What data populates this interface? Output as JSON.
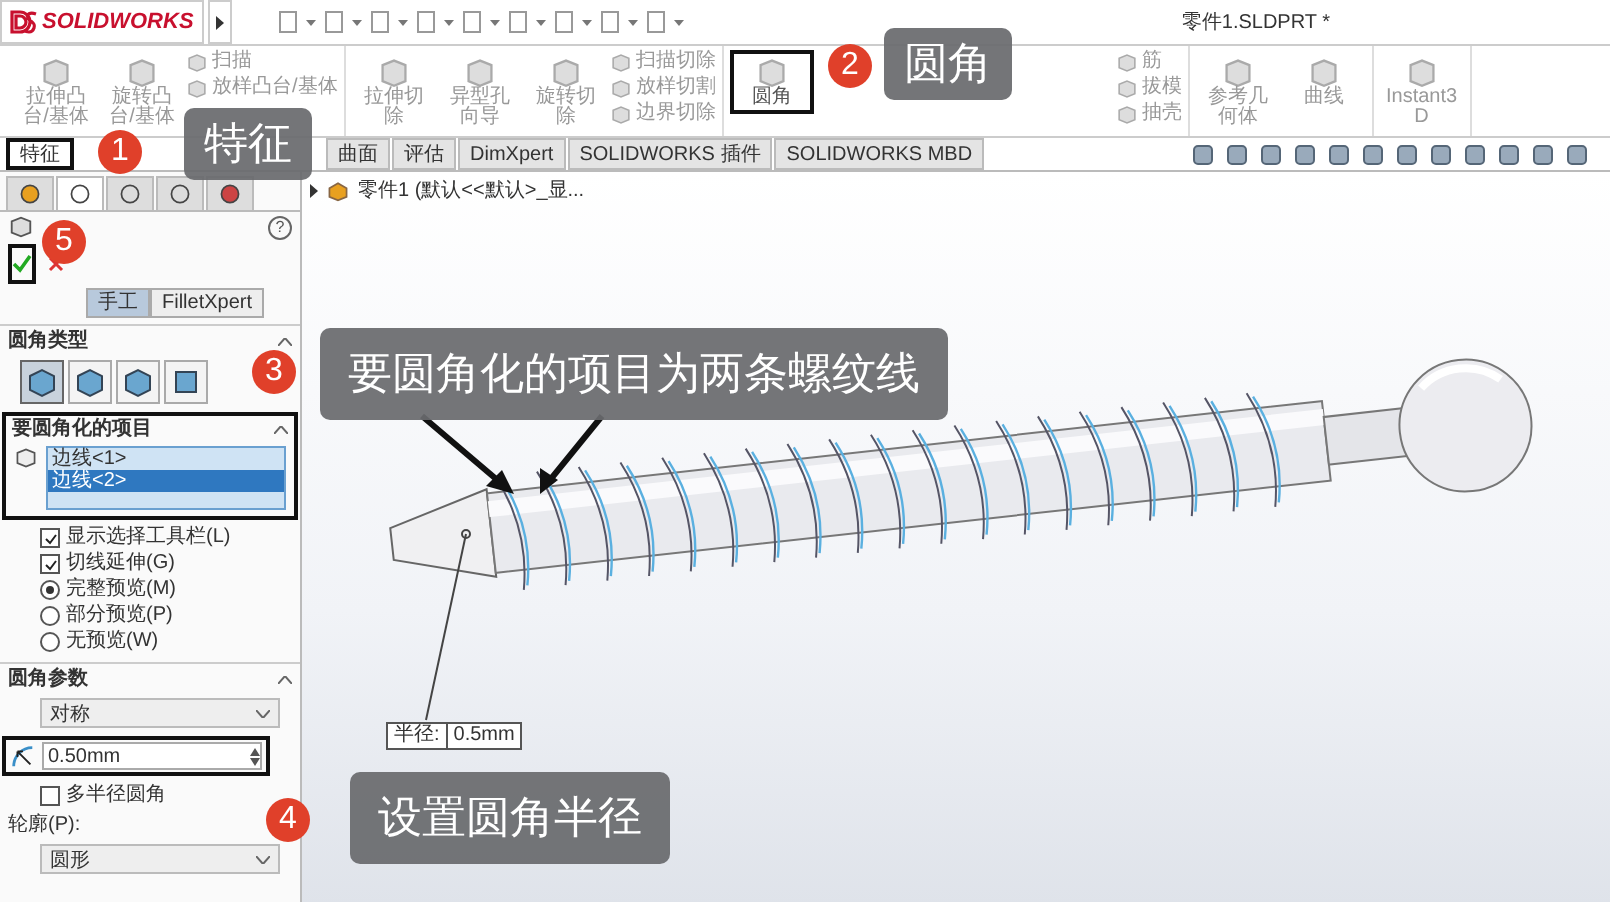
{
  "app": {
    "logo": "SOLIDWORKS",
    "title": "零件1.SLDPRT *"
  },
  "ribbon": {
    "groups": [
      {
        "items": [
          {
            "kind": "big",
            "label": "拉伸凸台/基体",
            "highlighted": false
          },
          {
            "kind": "big",
            "label": "旋转凸台/基体",
            "highlighted": false
          },
          {
            "kind": "small",
            "labels": [
              "扫描",
              "放样凸台/基体"
            ]
          }
        ]
      },
      {
        "items": [
          {
            "kind": "big",
            "label": "拉伸切除",
            "highlighted": false
          },
          {
            "kind": "big",
            "label": "异型孔向导",
            "highlighted": false
          },
          {
            "kind": "big",
            "label": "旋转切除",
            "highlighted": false
          },
          {
            "kind": "small",
            "labels": [
              "扫描切除",
              "放样切割",
              "边界切除"
            ]
          }
        ]
      },
      {
        "items": [
          {
            "kind": "big",
            "label": "圆角",
            "highlighted": true
          },
          {
            "kind": "small",
            "labels": [
              "筋",
              "拔模",
              "抽壳"
            ]
          }
        ]
      },
      {
        "items": [
          {
            "kind": "big",
            "label": "参考几何体",
            "highlighted": false
          },
          {
            "kind": "big",
            "label": "曲线",
            "highlighted": false
          }
        ]
      },
      {
        "items": [
          {
            "kind": "big",
            "label": "Instant3D",
            "highlighted": false
          }
        ]
      }
    ]
  },
  "tabs": [
    {
      "label": "特征",
      "selected": true,
      "highlighted": true
    },
    {
      "label": "曲面",
      "selected": false,
      "highlighted": false
    },
    {
      "label": "评估",
      "selected": false,
      "highlighted": false
    },
    {
      "label": "DimXpert",
      "selected": false,
      "highlighted": false
    },
    {
      "label": "SOLIDWORKS 插件",
      "selected": false,
      "highlighted": false
    },
    {
      "label": "SOLIDWORKS MBD",
      "selected": false,
      "highlighted": false
    }
  ],
  "panel": {
    "icon_tabs": [
      {
        "selected": false
      },
      {
        "selected": true
      },
      {
        "selected": false
      },
      {
        "selected": false
      },
      {
        "selected": false
      }
    ],
    "help": "?",
    "modes": [
      {
        "label": "手工",
        "selected": true
      },
      {
        "label": "FilletXpert",
        "selected": false
      }
    ],
    "fillet_type": {
      "title": "圆角类型",
      "types": [
        {
          "selected": true
        },
        {
          "selected": false
        },
        {
          "selected": false
        },
        {
          "selected": false
        }
      ]
    },
    "items": {
      "title": "要圆角化的项目",
      "edges": [
        {
          "label": "边线<1>",
          "selected": false
        },
        {
          "label": "边线<2>",
          "selected": true
        }
      ]
    },
    "options": [
      {
        "kind": "checkbox",
        "label": "显示选择工具栏(L)",
        "checked": true
      },
      {
        "kind": "checkbox",
        "label": "切线延伸(G)",
        "checked": true
      },
      {
        "kind": "radio",
        "label": "完整预览(M)",
        "checked": true
      },
      {
        "kind": "radio",
        "label": "部分预览(P)",
        "checked": false
      },
      {
        "kind": "radio",
        "label": "无预览(W)",
        "checked": false
      }
    ],
    "params": {
      "title": "圆角参数",
      "method": "对称",
      "radius": "0.50mm",
      "multi_radius": {
        "label": "多半径圆角",
        "checked": false
      },
      "profile_label": "轮廓(P):",
      "profile": "圆形"
    }
  },
  "viewport": {
    "breadcrumb": "零件1 (默认<<默认>_显...",
    "dimension": {
      "label": "半径:",
      "value": "0.5mm"
    }
  },
  "callouts": [
    {
      "number": "1",
      "text": "特征"
    },
    {
      "number": "2",
      "text": "圆角"
    },
    {
      "number": "3",
      "text": "要圆角化的项目为两条螺纹线"
    },
    {
      "number": "4",
      "text": "设置圆角半径"
    },
    {
      "number": "5"
    }
  ]
}
